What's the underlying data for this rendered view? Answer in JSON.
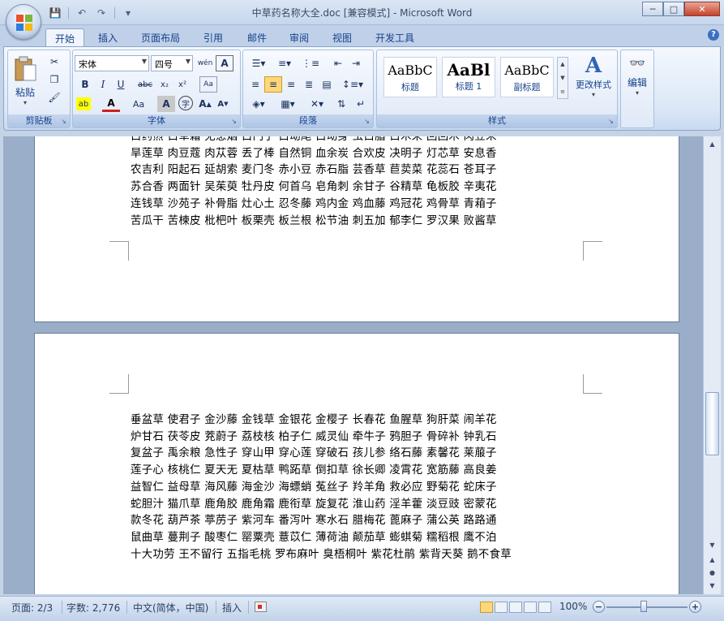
{
  "window": {
    "title": "中草药名称大全.doc [兼容模式] - Microsoft Word",
    "controls": {
      "minimize": "─",
      "maximize": "□",
      "close": "✕"
    }
  },
  "qat": {
    "save": "💾",
    "undo": "↶",
    "redo": "↷",
    "more": "▾"
  },
  "tabs": [
    "开始",
    "插入",
    "页面布局",
    "引用",
    "邮件",
    "审阅",
    "视图",
    "开发工具"
  ],
  "active_tab": "开始",
  "help": "?",
  "ribbon": {
    "clipboard": {
      "label": "剪贴板",
      "paste": "粘贴"
    },
    "font": {
      "label": "字体",
      "font_name": "宋体",
      "font_size": "四号"
    },
    "paragraph": {
      "label": "段落"
    },
    "styles": {
      "label": "样式",
      "items": [
        {
          "sample": "AaBbC",
          "name": "标题"
        },
        {
          "sample": "AaBl",
          "name": "标题 1"
        },
        {
          "sample": "AaBbC",
          "name": "副标题"
        }
      ],
      "change_styles": "更改样式"
    },
    "editing": {
      "label": "编辑"
    }
  },
  "document": {
    "page1_lines": [
      "白药煎 白草霜 无患烟 白门子 白动尾 白动身 虫白脂 白木来 回回木 肉豆末",
      "旱莲草 肉豆蔻 肉苁蓉 丢了棒 自然铜 血余炭 合欢皮 决明子 灯芯草 安息香",
      "农吉利 阳起石 延胡索 麦门冬 赤小豆 赤石脂 芸香草 苣荬菜 花蕊石 苍耳子",
      "苏合香 两面针 吴茱萸 牡丹皮 何首乌 皂角刺 余甘子 谷精草 龟板胶 辛夷花",
      "连钱草 沙苑子 补骨脂 灶心土 忍冬藤 鸡内金 鸡血藤 鸡冠花 鸡骨草 青葙子",
      "苦瓜干 苦楝皮 枇杷叶 板栗壳 板兰根 松节油 刺五加 郁李仁 罗汉果 败酱草"
    ],
    "page2_lines": [
      "垂盆草 使君子 金沙藤 金钱草 金银花 金樱子 长春花 鱼腥草 狗肝菜 闹羊花",
      "炉甘石 茯苓皮 茺蔚子 荔枝核 柏子仁 威灵仙 牵牛子 鸦胆子 骨碎补 钟乳石",
      "复盆子 禹余粮 急性子 穿山甲 穿心莲 穿破石 孩儿参 络石藤 素馨花 莱菔子",
      "莲子心 核桃仁 夏天无 夏枯草 鸭跖草 倒扣草 徐长卿 凌霄花 宽筋藤 高良姜",
      "益智仁 益母草 海风藤 海金沙 海螵蛸 菟丝子 羚羊角 救必应 野菊花 蛇床子",
      "蛇胆汁 猫爪草 鹿角胶 鹿角霜 鹿衔草 旋复花 淮山药 淫羊藿 淡豆豉 密蒙花",
      "款冬花 葫芦茶 葶苈子 紫河车 番泻叶 寒水石 腊梅花 蓖麻子 蒲公英 路路通",
      "鼠曲草 蔓荆子 酸枣仁 罂粟壳 薏苡仁 薄荷油 颠茄草 蟛蜞菊 糯稻根 鹰不泊",
      "十大功劳 王不留行 五指毛桃 罗布麻叶 臭梧桐叶 紫花杜鹃 紫背天葵 鹅不食草"
    ]
  },
  "status": {
    "page": "页面: 2/3",
    "words": "字数: 2,776",
    "language": "中文(简体，中国)",
    "insert_mode": "插入",
    "zoom": "100%"
  }
}
